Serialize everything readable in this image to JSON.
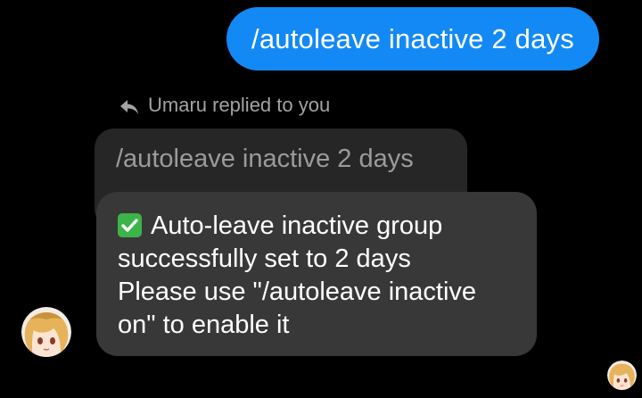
{
  "outgoing_message": {
    "text": "/autoleave inactive 2 days"
  },
  "reply_header": {
    "icon": "reply-arrow-icon",
    "label": "Umaru replied to you"
  },
  "quoted_message": {
    "text": "/autoleave inactive 2 days"
  },
  "incoming_message": {
    "icon": "green-checkmark-icon",
    "lines": [
      "Auto-leave inactive group",
      "successfully set to 2 days",
      "Please use \"/autoleave inactive",
      "on\" to enable it"
    ]
  },
  "avatars": {
    "sender": "avatar-umaru",
    "read_receipt": "avatar-umaru-seen"
  },
  "colors": {
    "background": "#000000",
    "outgoing_bubble": "#1389f5",
    "quoted_bubble": "#262626",
    "incoming_bubble": "#383838",
    "check": "#3cb44a"
  }
}
